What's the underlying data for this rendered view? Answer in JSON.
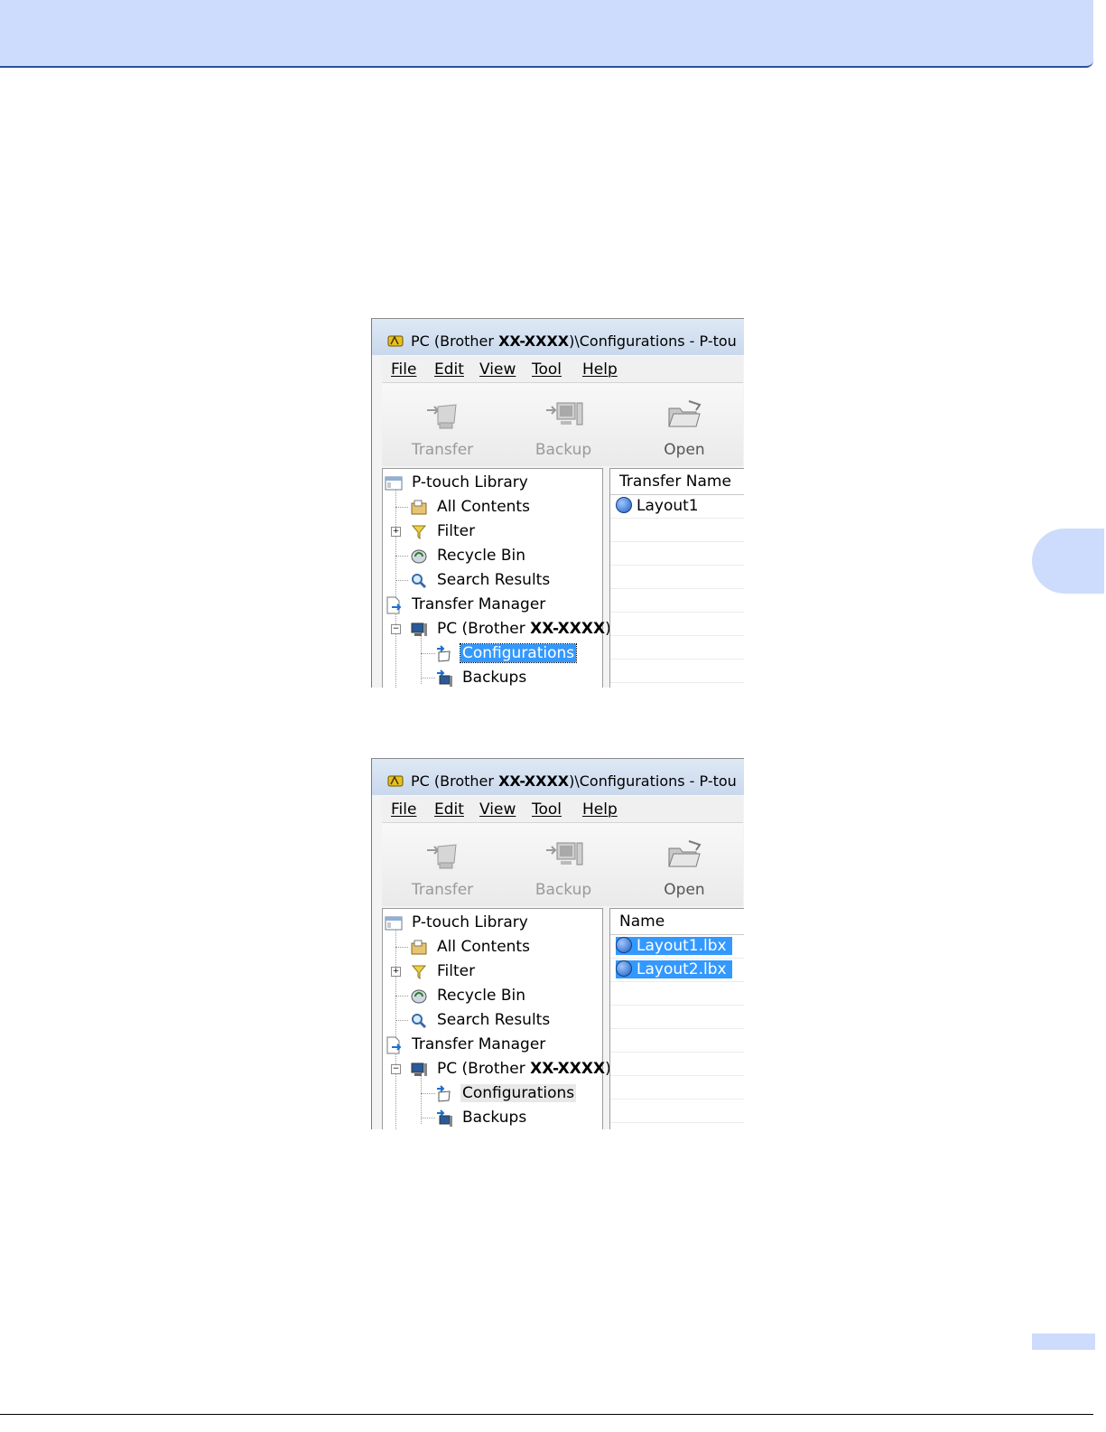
{
  "screens": [
    {
      "title_prefix": "PC (Brother ",
      "title_bold": "XX-XXXX",
      "title_suffix": ")\\Configurations - P-tou",
      "menu": [
        "File",
        "Edit",
        "View",
        "Tool",
        "Help"
      ],
      "toolbar": [
        "Transfer",
        "Backup",
        "Open"
      ],
      "tree": {
        "library": "P-touch Library",
        "all_contents": "All Contents",
        "filter": "Filter",
        "recycle_bin": "Recycle Bin",
        "search_results": "Search Results",
        "transfer_manager": "Transfer Manager",
        "pc_prefix": "PC (Brother ",
        "pc_bold": "XX-XXXX",
        "pc_suffix": ")",
        "configurations": "Configurations",
        "backups": "Backups"
      },
      "list_header": "Transfer Name",
      "files": [
        "Layout1"
      ]
    },
    {
      "title_prefix": "PC (Brother ",
      "title_bold": "XX-XXXX",
      "title_suffix": ")\\Configurations - P-tou",
      "menu": [
        "File",
        "Edit",
        "View",
        "Tool",
        "Help"
      ],
      "toolbar": [
        "Transfer",
        "Backup",
        "Open"
      ],
      "tree": {
        "library": "P-touch Library",
        "all_contents": "All Contents",
        "filter": "Filter",
        "recycle_bin": "Recycle Bin",
        "search_results": "Search Results",
        "transfer_manager": "Transfer Manager",
        "pc_prefix": "PC (Brother ",
        "pc_bold": "XX-XXXX",
        "pc_suffix": ")",
        "configurations": "Configurations",
        "backups": "Backups"
      },
      "list_header": "Name",
      "files": [
        "Layout1.lbx",
        "Layout2.lbx"
      ]
    }
  ],
  "colors": {
    "header_band": "#cddcfc",
    "selection": "#3399ff"
  }
}
